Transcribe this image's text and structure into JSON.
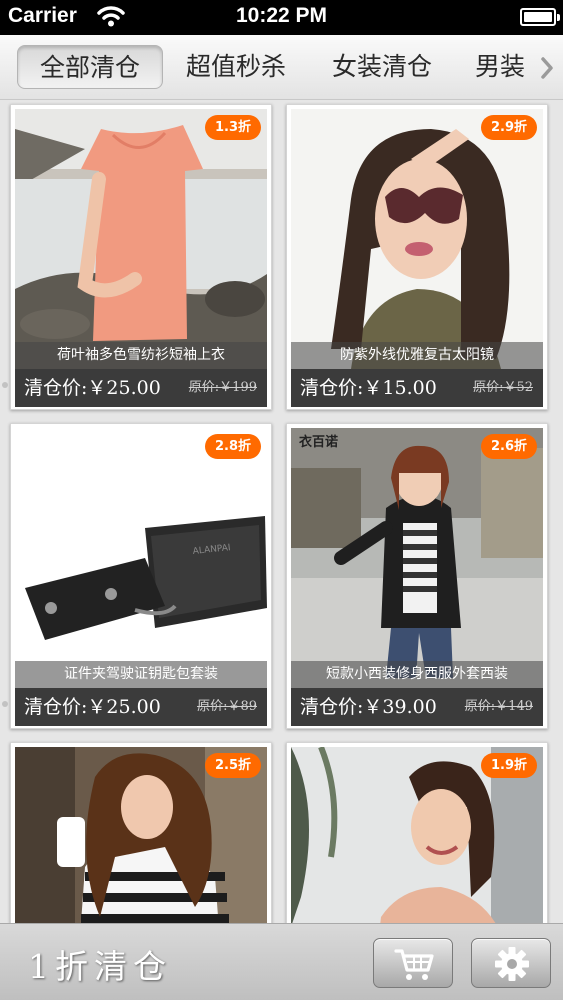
{
  "status_bar": {
    "carrier": "Carrier",
    "time": "10:22 PM"
  },
  "tabs": [
    {
      "label": "全部清仓",
      "active": true
    },
    {
      "label": "超值秒杀",
      "active": false
    },
    {
      "label": "女装清仓",
      "active": false
    },
    {
      "label": "男装",
      "active": false
    }
  ],
  "products": [
    {
      "title": "荷叶袖多色雪纺衫短袖上衣",
      "price": "清仓价:￥25.00",
      "original": "原价:￥199",
      "discount": "1.3折"
    },
    {
      "title": "防紫外线优雅复古太阳镜",
      "price": "清仓价:￥15.00",
      "original": "原价:￥52",
      "discount": "2.9折"
    },
    {
      "title": "证件夹驾驶证钥匙包套装",
      "price": "清仓价:￥25.00",
      "original": "原价:￥89",
      "discount": "2.8折"
    },
    {
      "title": "短款小西装修身西服外套西装",
      "price": "清仓价:￥39.00",
      "original": "原价:￥149",
      "discount": "2.6折",
      "photo_label": "衣百诺"
    },
    {
      "title": "",
      "price": "",
      "original": "",
      "discount": "2.5折"
    },
    {
      "title": "",
      "price": "",
      "original": "",
      "discount": "1.9折"
    }
  ],
  "bottom_bar": {
    "brand": "1折清仓"
  },
  "icons": {
    "tab_next": "chevron-right-icon",
    "cart": "shopping-cart-icon",
    "settings": "gear-icon"
  },
  "colors": {
    "badge": "#ff6a00",
    "price_bar": "#3b3b3b"
  }
}
